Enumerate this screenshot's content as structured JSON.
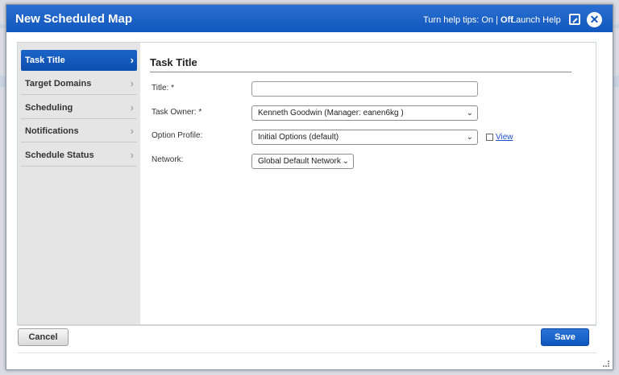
{
  "dialog": {
    "title": "New Scheduled Map",
    "help_tips_label": "Turn help tips:",
    "help_on": "On",
    "help_separator": "|",
    "help_off": "Off",
    "launch_help": "Launch Help",
    "close_glyph": "✕"
  },
  "sidebar": {
    "items": [
      {
        "label": "Task Title",
        "active": true
      },
      {
        "label": "Target Domains",
        "active": false
      },
      {
        "label": "Scheduling",
        "active": false
      },
      {
        "label": "Notifications",
        "active": false
      },
      {
        "label": "Schedule Status",
        "active": false
      }
    ],
    "chevron": "›"
  },
  "main": {
    "section_title": "Task Title",
    "fields": {
      "title": {
        "label": "Title: *",
        "value": "",
        "placeholder": ""
      },
      "task_owner": {
        "label": "Task Owner: *",
        "value": "Kenneth Goodwin (Manager: eanen6kg )"
      },
      "option_profile": {
        "label": "Option Profile:",
        "value": "Initial Options (default)",
        "view_link": "View"
      },
      "network": {
        "label": "Network:",
        "value": "Global Default Network"
      }
    },
    "caret": "⌄"
  },
  "footer": {
    "cancel_label": "Cancel",
    "save_label": "Save"
  },
  "icons": [
    "popout-icon",
    "close-icon",
    "chevron-right-icon",
    "view-icon"
  ],
  "colors": {
    "accent": "#1257bd",
    "sidebar_bg": "#e5e5e5",
    "link": "#1a4fc8"
  }
}
